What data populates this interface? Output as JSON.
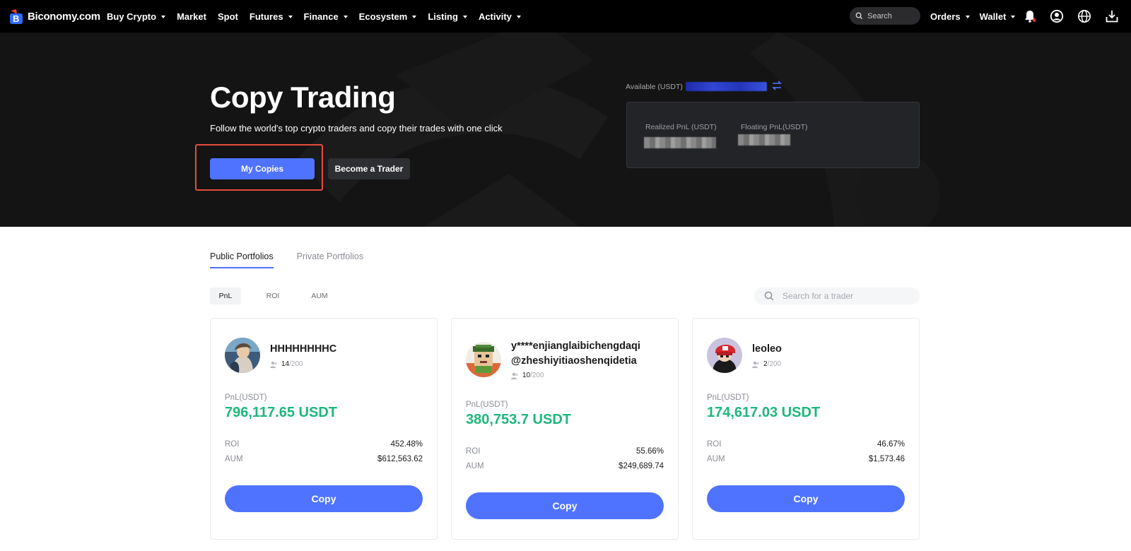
{
  "nav": {
    "logo_text": "Biconomy.com",
    "items": [
      {
        "label": "Buy Crypto",
        "dropdown": true
      },
      {
        "label": "Market",
        "dropdown": false
      },
      {
        "label": "Spot",
        "dropdown": false
      },
      {
        "label": "Futures",
        "dropdown": true
      },
      {
        "label": "Finance",
        "dropdown": true
      },
      {
        "label": "Ecosystem",
        "dropdown": true
      },
      {
        "label": "Listing",
        "dropdown": true
      },
      {
        "label": "Activity",
        "dropdown": true
      }
    ],
    "search_placeholder": "Search",
    "orders_label": "Orders",
    "wallet_label": "Wallet"
  },
  "hero": {
    "title": "Copy Trading",
    "subtitle": "Follow the world's top crypto traders and copy their trades with one click",
    "my_copies_label": "My Copies",
    "become_trader_label": "Become a Trader",
    "available_label": "Available (USDT)",
    "realized_label": "Realized PnL (USDT)",
    "floating_label": "Floating PnL(USDT)"
  },
  "tabs": [
    "Public Portfolios",
    "Private Portfolios"
  ],
  "filters": [
    "PnL",
    "ROI",
    "AUM"
  ],
  "search": {
    "placeholder": "Search for a trader"
  },
  "traders": [
    {
      "name": "HHHHHHHHC",
      "followers": "14",
      "max_followers": "/200",
      "pnl_label": "PnL(USDT)",
      "pnl": "796,117.65 USDT",
      "roi_label": "ROI",
      "roi": "452.48%",
      "aum_label": "AUM",
      "aum": "$612,563.62",
      "copy_label": "Copy"
    },
    {
      "name": "y****enjianglaibichengdaqi @zheshiyitiaoshenqidetia",
      "followers": "10",
      "max_followers": "/200",
      "pnl_label": "PnL(USDT)",
      "pnl": "380,753.7 USDT",
      "roi_label": "ROI",
      "roi": "55.66%",
      "aum_label": "AUM",
      "aum": "$249,689.74",
      "copy_label": "Copy"
    },
    {
      "name": "leoleo",
      "followers": "2",
      "max_followers": "/200",
      "pnl_label": "PnL(USDT)",
      "pnl": "174,617.03 USDT",
      "roi_label": "ROI",
      "roi": "46.67%",
      "aum_label": "AUM",
      "aum": "$1,573.46",
      "copy_label": "Copy"
    }
  ],
  "colors": {
    "accent": "#4f73ff",
    "pnl_green": "#1db87c",
    "highlight": "#e74c3c"
  }
}
